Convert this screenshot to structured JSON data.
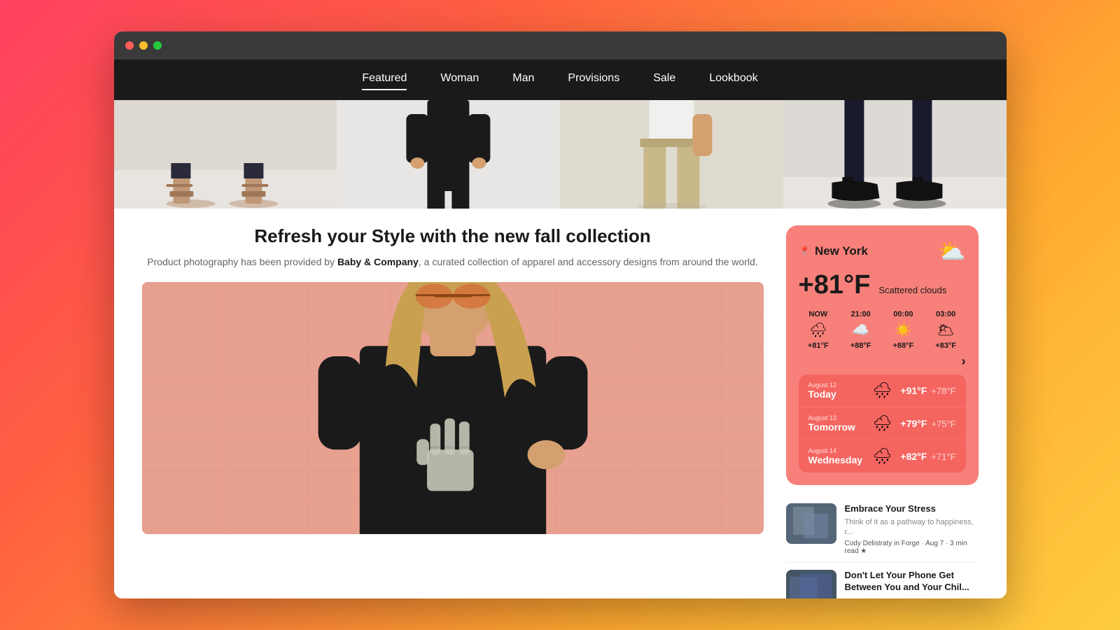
{
  "browser": {
    "dots": [
      "red",
      "yellow",
      "green"
    ]
  },
  "nav": {
    "items": [
      {
        "id": "featured",
        "label": "Featured",
        "active": true
      },
      {
        "id": "woman",
        "label": "Woman",
        "active": false
      },
      {
        "id": "man",
        "label": "Man",
        "active": false
      },
      {
        "id": "provisions",
        "label": "Provisions",
        "active": false
      },
      {
        "id": "sale",
        "label": "Sale",
        "active": false
      },
      {
        "id": "lookbook",
        "label": "Lookbook",
        "active": false
      }
    ]
  },
  "hero": {
    "title": "Refresh your Style with the new fall collection",
    "subtitle_pre": "Product photography has been provided by ",
    "subtitle_brand": "Baby & Company",
    "subtitle_post": ", a curated collection of apparel and accessory designs from around the world."
  },
  "weather": {
    "location": "New York",
    "temperature": "+81°F",
    "description": "Scattered clouds",
    "main_icon": "⛅",
    "hourly": [
      {
        "label": "NOW",
        "icon": "🌧",
        "temp": "+81°F"
      },
      {
        "label": "21:00",
        "icon": "☁",
        "temp": "+88°F"
      },
      {
        "label": "00:00",
        "icon": "☀",
        "temp": "+88°F"
      },
      {
        "label": "03:00",
        "icon": "🌥",
        "temp": "+83°F"
      }
    ],
    "forecast": [
      {
        "date": "August 12",
        "day": "Today",
        "icon": "🌧",
        "high": "+91°F",
        "low": "+78°F"
      },
      {
        "date": "August 13",
        "day": "Tomorrow",
        "icon": "🌧",
        "high": "+79°F",
        "low": "+75°F"
      },
      {
        "date": "August 14",
        "day": "Wednesday",
        "icon": "🌧",
        "high": "+82°F",
        "low": "+71°F"
      }
    ]
  },
  "blog_posts": [
    {
      "title": "Embrace Your Stress",
      "excerpt": "Think of it as a pathway to happiness, r...",
      "author": "Cody Delistraty in Forge",
      "meta": "Aug 7 · 3 min read",
      "starred": true
    },
    {
      "title": "Don't Let Your Phone Get Between You and Your Chil...",
      "excerpt": "",
      "author": "",
      "meta": "",
      "starred": false
    }
  ]
}
